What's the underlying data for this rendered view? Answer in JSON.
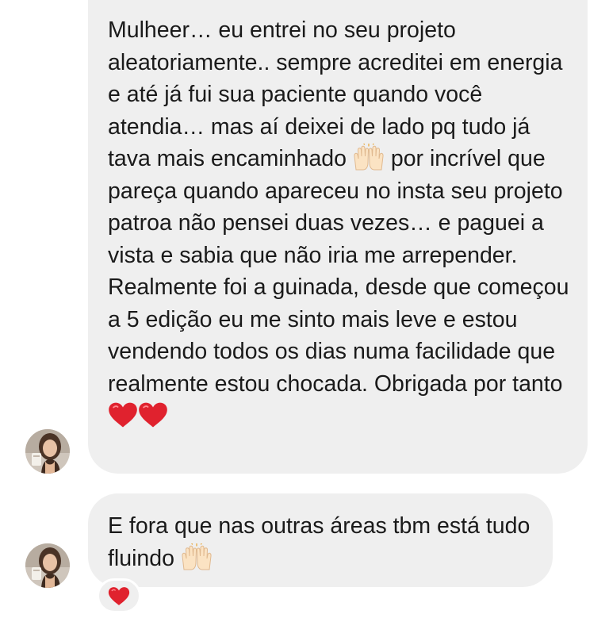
{
  "messages": [
    {
      "text_before_hands": "Mulheer… eu entrei no seu projeto aleatoriamente.. sempre acreditei em energia e até já fui sua paciente quando você atendia… mas aí deixei de lado pq tudo já tava mais encaminhado",
      "hands_emoji": "raising-hands-emoji",
      "text_after_hands": "por incrível que pareça quando apareceu no insta seu projeto patroa não pensei duas vezes… e paguei a vista e sabia que não iria me arrepender. Realmente foi a guinada, desde que começou a 5 edição eu me sinto mais leve e estou vendendo todos os dias numa facilidade que realmente estou chocada. Obrigada por tanto",
      "trailing_emojis": [
        "red-heart-emoji",
        "red-heart-emoji"
      ]
    },
    {
      "text": "E fora que nas outras áreas tbm está tudo fluindo",
      "trailing_emoji": "raising-hands-emoji",
      "reaction": "red-heart-emoji"
    }
  ],
  "colors": {
    "bubble_background": "#efefef",
    "text": "#1a1a1a",
    "page_background": "#ffffff",
    "heart": "#e0222e"
  }
}
